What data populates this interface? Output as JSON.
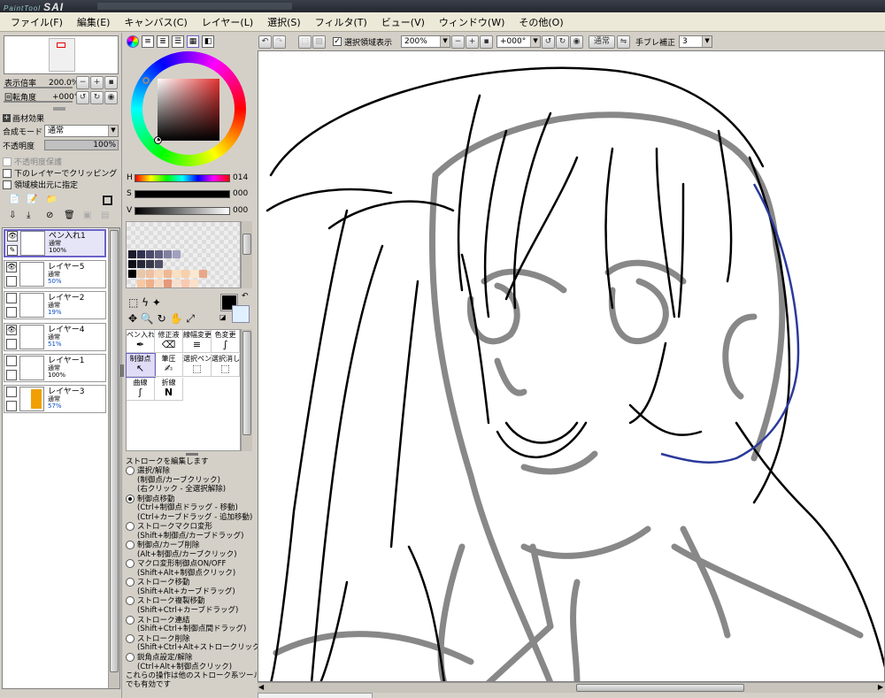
{
  "app": {
    "logo": "SAI",
    "logo_small": "PaintTool"
  },
  "menu": [
    "ファイル(F)",
    "編集(E)",
    "キャンバス(C)",
    "レイヤー(L)",
    "選択(S)",
    "フィルタ(T)",
    "ビュー(V)",
    "ウィンドウ(W)",
    "その他(O)"
  ],
  "navigator": {
    "zoom_label": "表示倍率",
    "zoom_value": "200.0%",
    "rotate_label": "回転角度",
    "rotate_value": "+000°"
  },
  "layer_props": {
    "effect_label": "画材効果",
    "blend_label": "合成モード",
    "blend_value": "通常",
    "opacity_label": "不透明度",
    "opacity_value": "100%",
    "protect_label": "不透明度保護",
    "clip_label": "下のレイヤーでクリッピング",
    "source_label": "領域検出元に指定"
  },
  "layers": [
    {
      "name": "ペン入れ1",
      "mode": "通常",
      "opacity": "100%",
      "selected": true,
      "visible": true
    },
    {
      "name": "レイヤー5",
      "mode": "通常",
      "opacity": "50%",
      "selected": false,
      "visible": true
    },
    {
      "name": "レイヤー2",
      "mode": "通常",
      "opacity": "19%",
      "selected": false,
      "visible": false
    },
    {
      "name": "レイヤー4",
      "mode": "通常",
      "opacity": "51%",
      "selected": false,
      "visible": true
    },
    {
      "name": "レイヤー1",
      "mode": "通常",
      "opacity": "100%",
      "selected": false,
      "visible": false
    },
    {
      "name": "レイヤー3",
      "mode": "通常",
      "opacity": "57%",
      "selected": false,
      "visible": false
    }
  ],
  "color": {
    "h_label": "H",
    "h_value": "014",
    "s_label": "S",
    "s_value": "000",
    "v_label": "V",
    "v_value": "000",
    "current": "#000000"
  },
  "tools": {
    "row1": [
      "ペン入れ",
      "修正液",
      "線幅変更",
      "色変更"
    ],
    "row2": [
      "制御点",
      "筆圧",
      "選択ペン",
      "選択消し"
    ],
    "row3": [
      "曲線",
      "折線"
    ]
  },
  "help": {
    "title": "ストロークを編集します",
    "items": [
      {
        "label": "選択/解除",
        "subs": [
          "(制御点/カーブクリック)",
          "(右クリック - 全選択解除)"
        ],
        "on": false
      },
      {
        "label": "制御点移動",
        "subs": [
          "(Ctrl+制御点ドラッグ - 移動)",
          "(Ctrl+カーブドラッグ - 追加移動)"
        ],
        "on": true
      },
      {
        "label": "ストロークマクロ変形",
        "subs": [
          "(Shift+制御点/カーブドラッグ)"
        ],
        "on": false
      },
      {
        "label": "制御点/カーブ削除",
        "subs": [
          "(Alt+制御点/カーブクリック)"
        ],
        "on": false
      },
      {
        "label": "マクロ変形制御点ON/OFF",
        "subs": [
          "(Shift+Alt+制御点クリック)"
        ],
        "on": false
      },
      {
        "label": "ストローク移動",
        "subs": [
          "(Shift+Alt+カーブドラッグ)"
        ],
        "on": false
      },
      {
        "label": "ストローク複製移動",
        "subs": [
          "(Shift+Ctrl+カーブドラッグ)"
        ],
        "on": false
      },
      {
        "label": "ストローク連結",
        "subs": [
          "(Shift+Ctrl+制御点間ドラッグ)"
        ],
        "on": false
      },
      {
        "label": "ストローク削除",
        "subs": [
          "(Shift+Ctrl+Alt+ストロークリック)"
        ],
        "on": false
      },
      {
        "label": "鋭角点設定/解除",
        "subs": [
          "(Ctrl+Alt+制御点クリック)"
        ],
        "on": false
      }
    ],
    "footer1": "これらの操作は他のストローク系ツール",
    "footer2": "でも有効です"
  },
  "canvas_toolbar": {
    "show_selection_label": "選択領域表示",
    "zoom_value": "200%",
    "angle_value": "+000°",
    "mode_value": "通常",
    "stabilizer_label": "手ブレ補正",
    "stabilizer_value": "3"
  }
}
